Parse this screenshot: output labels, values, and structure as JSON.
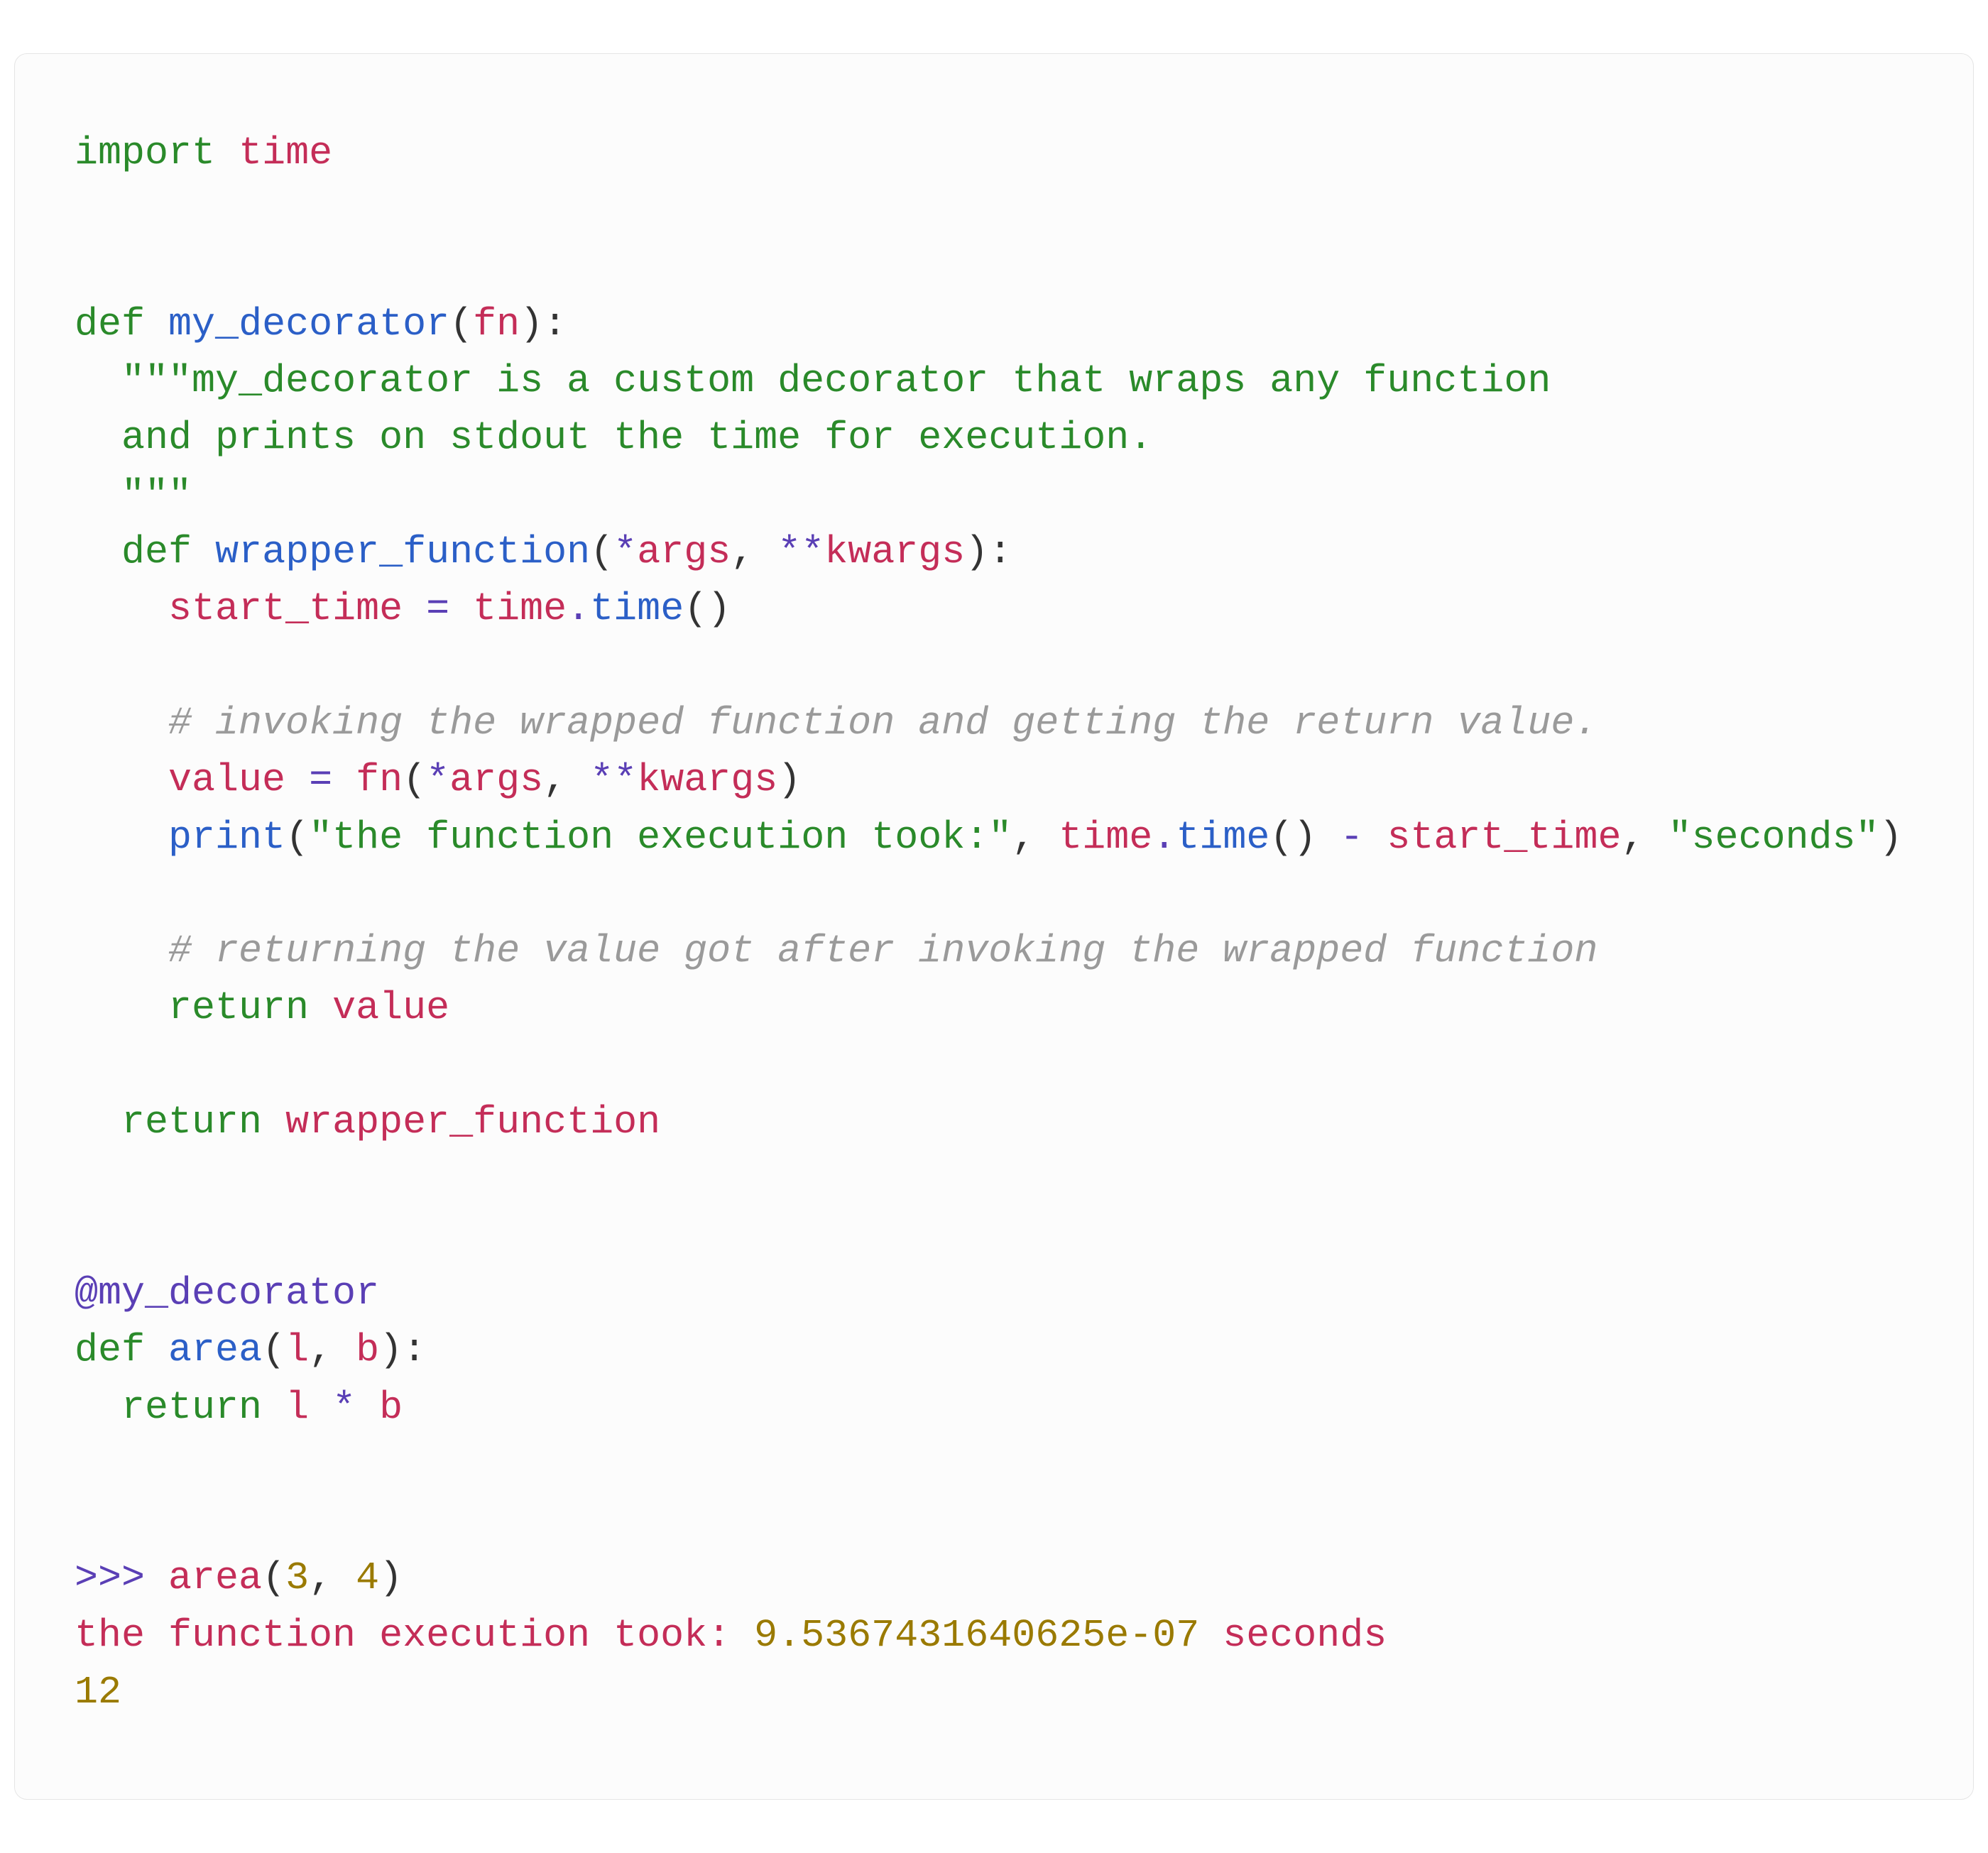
{
  "code": {
    "l1_import": "import",
    "l1_time": "time",
    "l3_def": "def",
    "l3_name": "my_decorator",
    "l3_p_open": "(",
    "l3_arg": "fn",
    "l3_p_close": "):",
    "l4_doc1": "\"\"\"my_decorator is a custom decorator that wraps any function",
    "l5_doc2": "  and prints on stdout the time for execution.",
    "l6_doc3": "  \"\"\"",
    "l7_def": "def",
    "l7_name": "wrapper_function",
    "l7_p_open": "(",
    "l7_star": "*",
    "l7_args": "args",
    "l7_comma": ", ",
    "l7_dstar": "**",
    "l7_kwargs": "kwargs",
    "l7_p_close": "):",
    "l8_var": "start_time",
    "l8_eq": " = ",
    "l8_time1": "time",
    "l8_dot": ".",
    "l8_time2": "time",
    "l8_call": "()",
    "l10_cmt": "# invoking the wrapped function and getting the return value.",
    "l11_var": "value",
    "l11_eq": " = ",
    "l11_fn": "fn",
    "l11_p_open": "(",
    "l11_star": "*",
    "l11_args": "args",
    "l11_comma": ", ",
    "l11_dstar": "**",
    "l11_kwargs": "kwargs",
    "l11_p_close": ")",
    "l12_print": "print",
    "l12_p_open": "(",
    "l12_str1": "\"the function execution took:\"",
    "l12_c1": ", ",
    "l12_time1": "time",
    "l12_dot": ".",
    "l12_time2": "time",
    "l12_call": "()",
    "l12_minus": " - ",
    "l12_var": "start_time",
    "l12_c2": ", ",
    "l12_str2": "\"seconds\"",
    "l12_p_close": ")",
    "l14_cmt": "# returning the value got after invoking the wrapped function",
    "l15_return": "return",
    "l15_var": "value",
    "l17_return": "return",
    "l17_var": "wrapper_function",
    "l20_at": "@my_decorator",
    "l21_def": "def",
    "l21_name": "area",
    "l21_p_open": "(",
    "l21_a": "l",
    "l21_comma": ", ",
    "l21_b": "b",
    "l21_p_close": "):",
    "l22_return": "return",
    "l22_l": "l",
    "l22_star": " * ",
    "l22_b": "b",
    "l25_prompt": ">>> ",
    "l25_fn": "area",
    "l25_p_open": "(",
    "l25_a": "3",
    "l25_comma": ", ",
    "l25_b": "4",
    "l25_p_close": ")",
    "l26_out": "the function execution took: ",
    "l26_num": "9.5367431640625e-07",
    "l26_sec": " seconds",
    "l27_out": "12"
  }
}
